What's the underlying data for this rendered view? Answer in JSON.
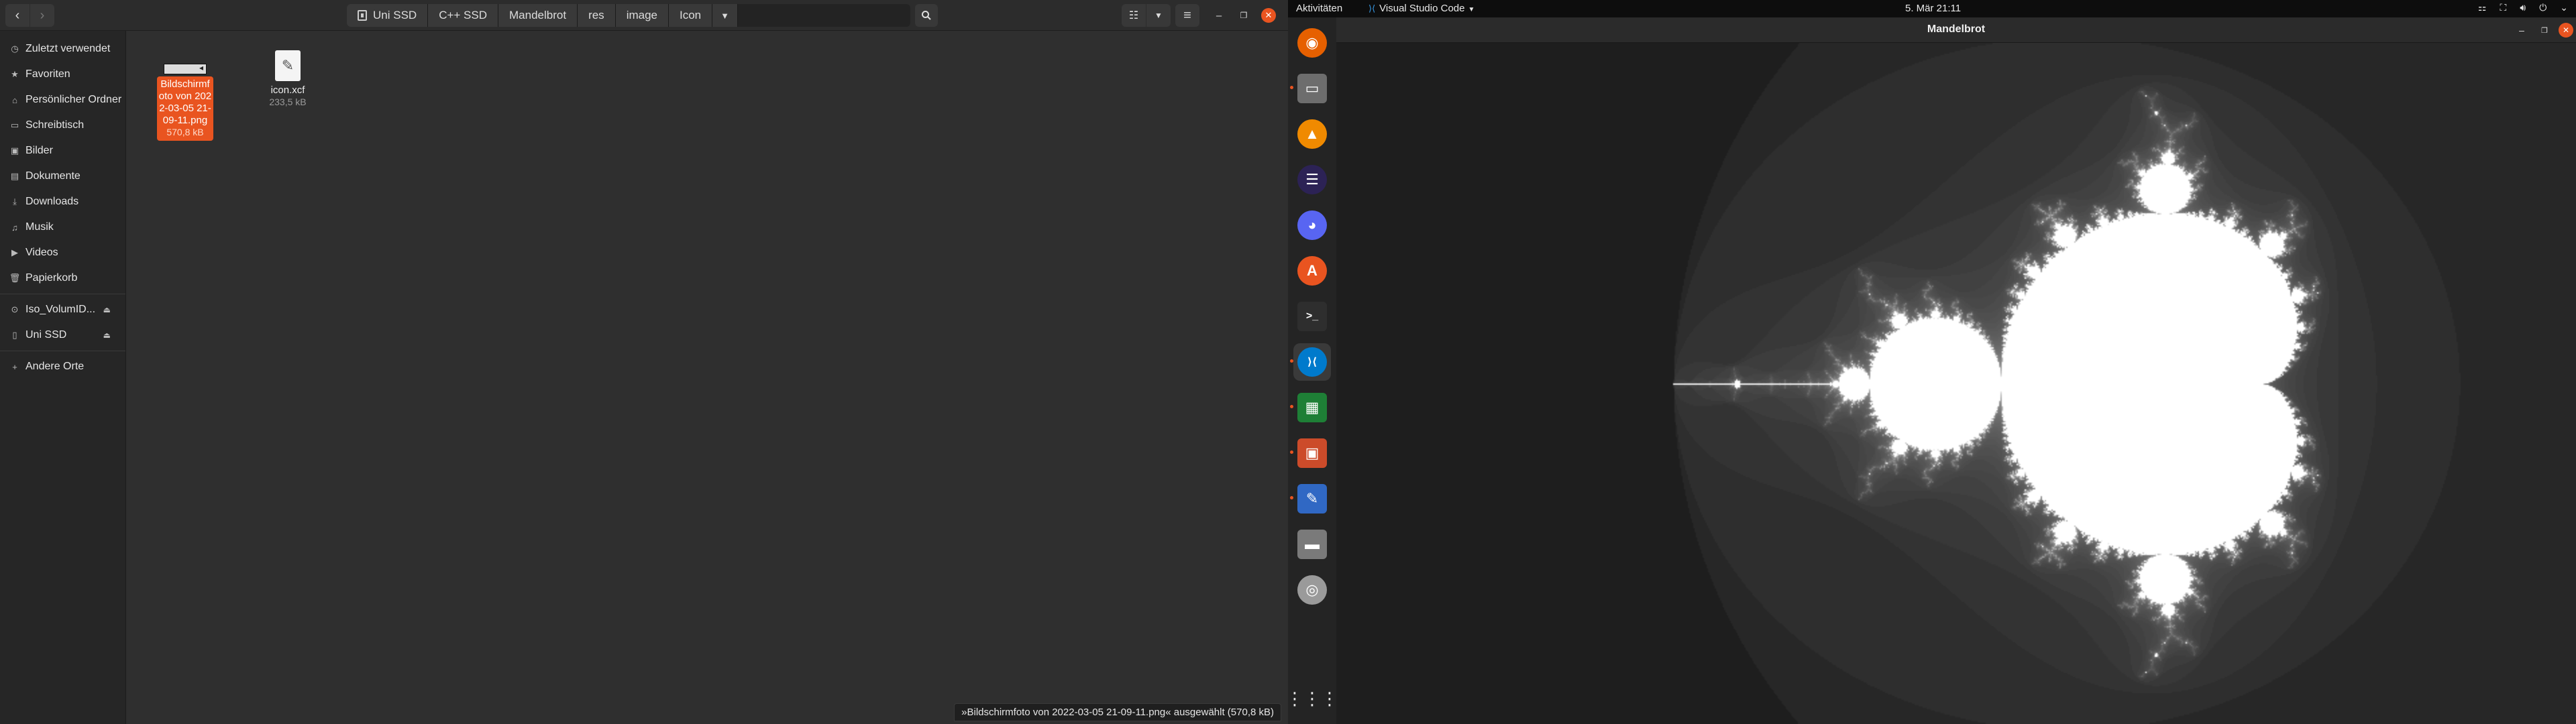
{
  "files": {
    "breadcrumbs": [
      "Uni SSD",
      "C++ SSD",
      "Mandelbrot",
      "res",
      "image",
      "Icon"
    ],
    "sidebar": [
      {
        "label": "Zuletzt verwendet",
        "icon": "clock-icon"
      },
      {
        "label": "Favoriten",
        "icon": "star-icon"
      },
      {
        "label": "Persönlicher Ordner",
        "icon": "home-icon"
      },
      {
        "label": "Schreibtisch",
        "icon": "desktop-icon"
      },
      {
        "label": "Bilder",
        "icon": "pictures-icon"
      },
      {
        "label": "Dokumente",
        "icon": "documents-icon"
      },
      {
        "label": "Downloads",
        "icon": "downloads-icon"
      },
      {
        "label": "Musik",
        "icon": "music-icon"
      },
      {
        "label": "Videos",
        "icon": "videos-icon"
      },
      {
        "label": "Papierkorb",
        "icon": "trash-icon"
      }
    ],
    "devices": [
      {
        "label": "Iso_VolumID...",
        "icon": "drive-icon"
      },
      {
        "label": "Uni SSD",
        "icon": "drive-icon"
      }
    ],
    "other_places": "Andere Orte",
    "items": [
      {
        "name": "Bildschirmfoto von 2022-03-05 21-09-11.png",
        "size": "570,8 kB",
        "selected": true
      },
      {
        "name": "icon.xcf",
        "size": "233,5 kB",
        "selected": false
      }
    ],
    "status": "»Bildschirmfoto von 2022-03-05 21-09-11.png« ausgewählt (570,8 kB)"
  },
  "topbar": {
    "activities": "Aktivitäten",
    "app_name": "Visual Studio Code",
    "clock": "5. Mär  21:11"
  },
  "dock": {
    "apps": [
      {
        "name": "firefox",
        "color": "#e66000",
        "glyph": "◉"
      },
      {
        "name": "files",
        "color": "#6d6d6d",
        "glyph": "▭"
      },
      {
        "name": "vlc",
        "color": "#f08a00",
        "glyph": "▲"
      },
      {
        "name": "eclipse",
        "color": "#2c2255",
        "glyph": "☰"
      },
      {
        "name": "discord",
        "color": "#5865f2",
        "glyph": "◕"
      },
      {
        "name": "software",
        "color": "#e95420",
        "glyph": "A"
      },
      {
        "name": "terminal",
        "color": "#2e2e2e",
        "glyph": ">_"
      },
      {
        "name": "vscode",
        "color": "#007acc",
        "glyph": "⟩⟨"
      },
      {
        "name": "sheet",
        "color": "#1e7f36",
        "glyph": "▦"
      },
      {
        "name": "impress",
        "color": "#cc4b2a",
        "glyph": "▣"
      },
      {
        "name": "editor",
        "color": "#3068c4",
        "glyph": "✎"
      },
      {
        "name": "drive",
        "color": "#7a7a7a",
        "glyph": "▬"
      },
      {
        "name": "disc",
        "color": "#9a9a9a",
        "glyph": "◎"
      }
    ]
  },
  "mandel": {
    "title": "Mandelbrot"
  },
  "colors": {
    "accent": "#e95420",
    "nautilus_bg": "#2f2f2f",
    "sidebar_bg": "#262626"
  }
}
